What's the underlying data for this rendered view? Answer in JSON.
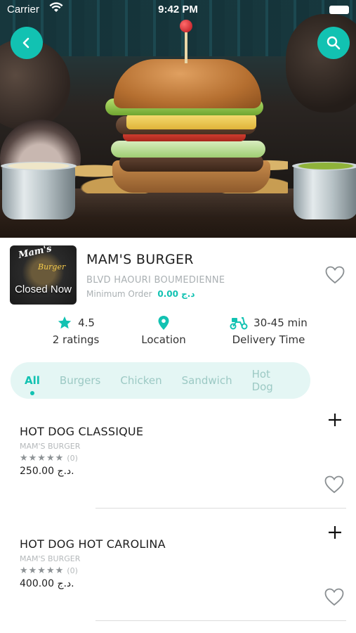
{
  "status_bar": {
    "carrier": "Carrier",
    "time": "9:42 PM"
  },
  "restaurant": {
    "logo_word": "Mam's",
    "logo_sub": "Burger",
    "status": "Closed Now",
    "name": "MAM'S BURGER",
    "address": "BLVD HAOURI BOUMEDIENNE",
    "min_order_label": "Minimum Order",
    "min_order_value": "0.00 د.ج"
  },
  "stats": {
    "rating": "4.5",
    "ratings_count": "2 ratings",
    "location_label": "Location",
    "delivery_time": "30-45 min",
    "delivery_label": "Delivery Time"
  },
  "tabs": [
    {
      "label": "All",
      "active": true
    },
    {
      "label": "Burgers"
    },
    {
      "label": "Chicken"
    },
    {
      "label": "Sandwich"
    },
    {
      "label": "Hot Dog"
    }
  ],
  "items": [
    {
      "name": "HOT DOG CLASSIQUE",
      "brand": "MAM'S BURGER",
      "stars": "★★★★★",
      "rating_count": "(0)",
      "price": "250.00 د.ج."
    },
    {
      "name": "HOT DOG HOT CAROLINA",
      "brand": "MAM'S BURGER",
      "stars": "★★★★★",
      "rating_count": "(0)",
      "price": "400.00 د.ج."
    }
  ],
  "colors": {
    "accent": "#12c2b2",
    "tab_bg": "#e4f6f4",
    "muted": "#aab0b3"
  },
  "icons": {
    "back": "chevron-left-icon",
    "search": "search-icon",
    "favorite": "heart-icon",
    "rating": "star-icon",
    "location": "location-pin-icon",
    "delivery": "scooter-icon",
    "add": "plus-icon"
  }
}
